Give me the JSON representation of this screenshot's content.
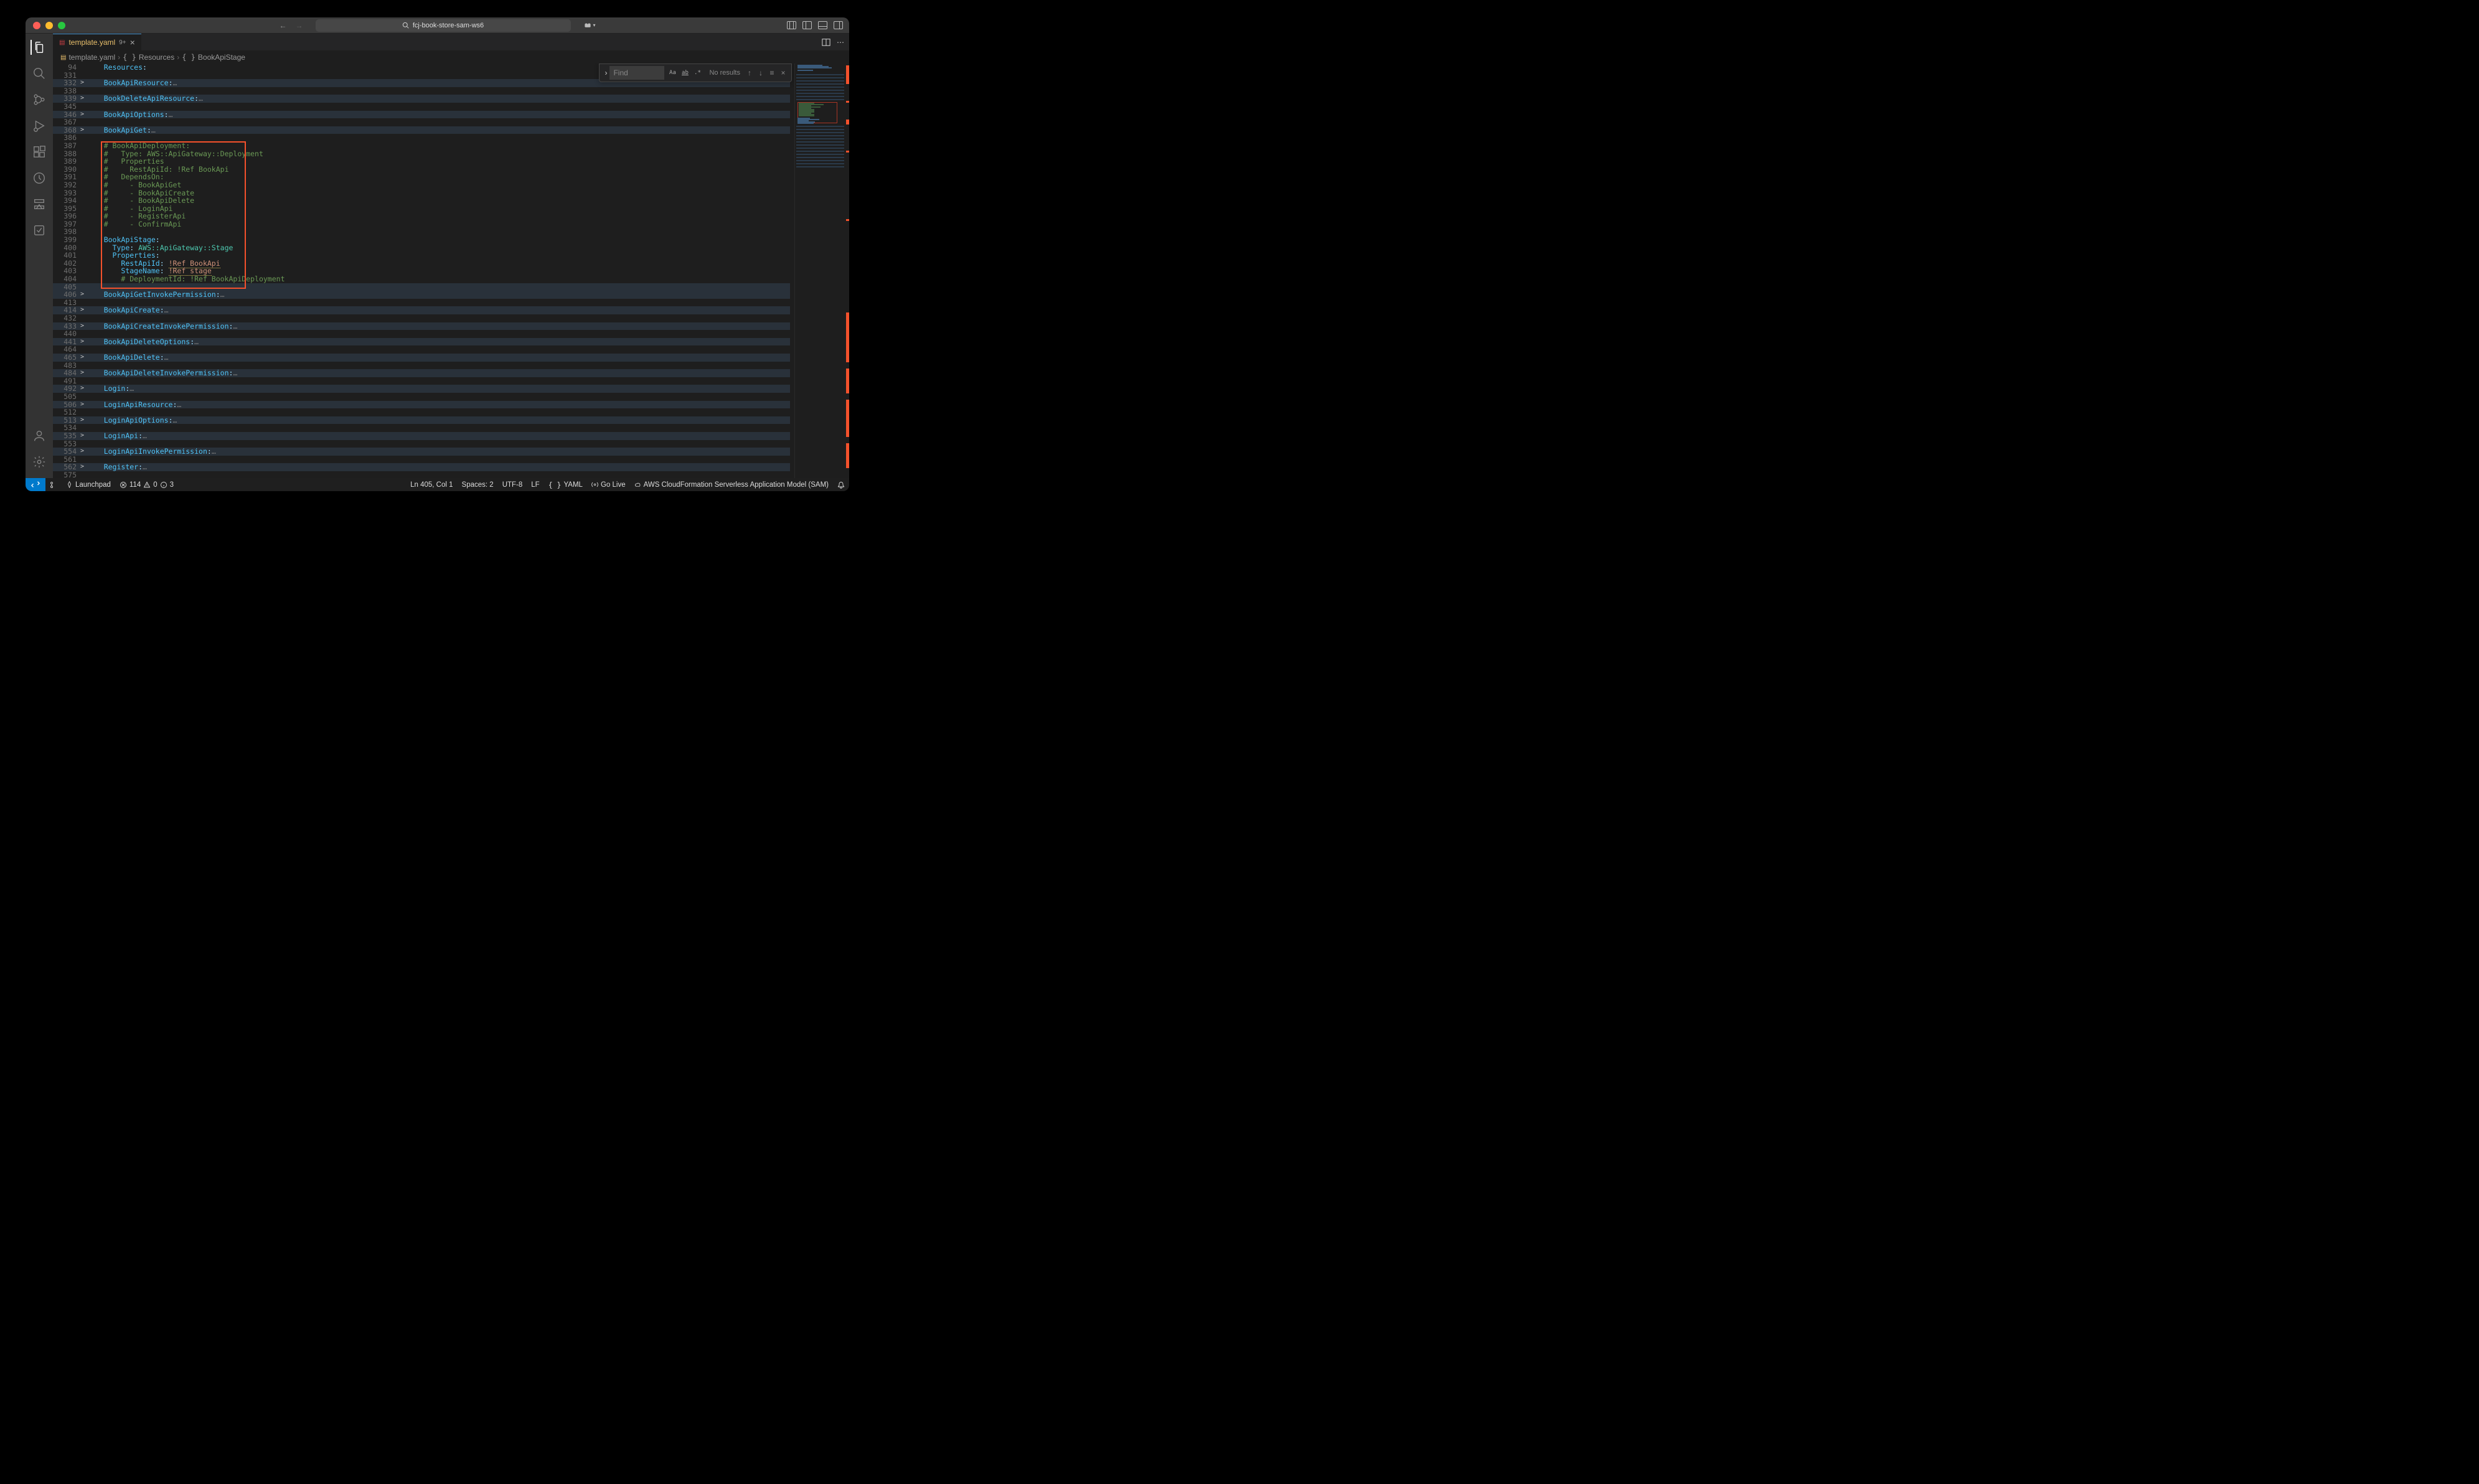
{
  "titlebar": {
    "url": "fcj-book-store-sam-ws6"
  },
  "tab": {
    "filename": "template.yaml",
    "dirty_badge": "9+"
  },
  "breadcrumb": {
    "file": "template.yaml",
    "seg1": "Resources",
    "seg2": "BookApiStage"
  },
  "find": {
    "placeholder": "Find",
    "results": "No results"
  },
  "code_lines": [
    {
      "n": 94,
      "fold": "",
      "cls": "",
      "html": "    <span class='c-key'>Resources</span>:"
    },
    {
      "n": 331,
      "fold": "",
      "cls": "empty",
      "html": " "
    },
    {
      "n": 332,
      "fold": ">",
      "cls": "folded",
      "html": "    <span class='c-key'>BookApiResource</span>:<span class='c-elide'>…</span>"
    },
    {
      "n": 338,
      "fold": "",
      "cls": "empty",
      "html": " "
    },
    {
      "n": 339,
      "fold": ">",
      "cls": "folded",
      "html": "    <span class='c-key'>BookDeleteApiResource</span>:<span class='c-elide'>…</span>"
    },
    {
      "n": 345,
      "fold": "",
      "cls": "empty",
      "html": " "
    },
    {
      "n": 346,
      "fold": ">",
      "cls": "folded",
      "html": "    <span class='c-key'>BookApiOptions</span>:<span class='c-elide'>…</span>"
    },
    {
      "n": 367,
      "fold": "",
      "cls": "empty",
      "html": " "
    },
    {
      "n": 368,
      "fold": ">",
      "cls": "folded",
      "html": "    <span class='c-key'>BookApiGet</span>:<span class='c-elide'>…</span>"
    },
    {
      "n": 386,
      "fold": "",
      "cls": "empty",
      "html": " "
    },
    {
      "n": 387,
      "fold": "",
      "cls": "",
      "html": "    <span class='c-comment'># BookApiDeployment:</span>"
    },
    {
      "n": 388,
      "fold": "",
      "cls": "",
      "html": "    <span class='c-comment'>#   Type: AWS::ApiGateway::Deployment</span>"
    },
    {
      "n": 389,
      "fold": "",
      "cls": "",
      "html": "    <span class='c-comment'>#   Properties</span>"
    },
    {
      "n": 390,
      "fold": "",
      "cls": "",
      "html": "    <span class='c-comment'>#     RestApiId: !Ref BookApi</span>"
    },
    {
      "n": 391,
      "fold": "",
      "cls": "",
      "html": "    <span class='c-comment'>#   DependsOn:</span>"
    },
    {
      "n": 392,
      "fold": "",
      "cls": "",
      "html": "    <span class='c-comment'>#     - BookApiGet</span>"
    },
    {
      "n": 393,
      "fold": "",
      "cls": "",
      "html": "    <span class='c-comment'>#     - BookApiCreate</span>"
    },
    {
      "n": 394,
      "fold": "",
      "cls": "",
      "html": "    <span class='c-comment'>#     - BookApiDelete</span>"
    },
    {
      "n": 395,
      "fold": "",
      "cls": "",
      "html": "    <span class='c-comment'>#     - LoginApi</span>"
    },
    {
      "n": 396,
      "fold": "",
      "cls": "",
      "html": "    <span class='c-comment'>#     - RegisterApi</span>"
    },
    {
      "n": 397,
      "fold": "",
      "cls": "",
      "html": "    <span class='c-comment'>#     - ConfirmApi</span>"
    },
    {
      "n": 398,
      "fold": "",
      "cls": "empty",
      "html": " "
    },
    {
      "n": 399,
      "fold": "",
      "cls": "",
      "html": "    <span class='c-key'>BookApiStage</span>:"
    },
    {
      "n": 400,
      "fold": "",
      "cls": "",
      "html": "      <span class='c-key'>Type</span>: <span class='c-type'>AWS::ApiGateway::Stage</span>"
    },
    {
      "n": 401,
      "fold": "",
      "cls": "",
      "html": "      <span class='c-key'>Properties</span>:"
    },
    {
      "n": 402,
      "fold": "",
      "cls": "",
      "html": "        <span class='c-key'>RestApiId</span>: <span class='c-tag underline-warn'>!Ref BookApi</span>"
    },
    {
      "n": 403,
      "fold": "",
      "cls": "",
      "html": "        <span class='c-key'>StageName</span>: <span class='c-tag underline-warn'>!Ref stage</span>"
    },
    {
      "n": 404,
      "fold": "",
      "cls": "",
      "html": "        <span class='c-comment'># DeploymentId: !Ref BookApiDeployment</span>"
    },
    {
      "n": 405,
      "fold": "",
      "cls": "folded",
      "html": " "
    },
    {
      "n": 406,
      "fold": ">",
      "cls": "folded",
      "html": "    <span class='c-key'>BookApiGetInvokePermission</span>:<span class='c-elide'>…</span>"
    },
    {
      "n": 413,
      "fold": "",
      "cls": "empty",
      "html": " "
    },
    {
      "n": 414,
      "fold": ">",
      "cls": "folded",
      "html": "    <span class='c-key'>BookApiCreate</span>:<span class='c-elide'>…</span>"
    },
    {
      "n": 432,
      "fold": "",
      "cls": "empty",
      "html": " "
    },
    {
      "n": 433,
      "fold": ">",
      "cls": "folded",
      "html": "    <span class='c-key'>BookApiCreateInvokePermission</span>:<span class='c-elide'>…</span>"
    },
    {
      "n": 440,
      "fold": "",
      "cls": "empty",
      "html": " "
    },
    {
      "n": 441,
      "fold": ">",
      "cls": "folded",
      "html": "    <span class='c-key'>BookApiDeleteOptions</span>:<span class='c-elide'>…</span>"
    },
    {
      "n": 464,
      "fold": "",
      "cls": "empty",
      "html": " "
    },
    {
      "n": 465,
      "fold": ">",
      "cls": "folded",
      "html": "    <span class='c-key'>BookApiDelete</span>:<span class='c-elide'>…</span>"
    },
    {
      "n": 483,
      "fold": "",
      "cls": "empty",
      "html": " "
    },
    {
      "n": 484,
      "fold": ">",
      "cls": "folded",
      "html": "    <span class='c-key'>BookApiDeleteInvokePermission</span>:<span class='c-elide'>…</span>"
    },
    {
      "n": 491,
      "fold": "",
      "cls": "empty",
      "html": " "
    },
    {
      "n": 492,
      "fold": ">",
      "cls": "folded",
      "html": "    <span class='c-key'>Login</span>:<span class='c-elide'>…</span>"
    },
    {
      "n": 505,
      "fold": "",
      "cls": "empty",
      "html": " "
    },
    {
      "n": 506,
      "fold": ">",
      "cls": "folded",
      "html": "    <span class='c-key'>LoginApiResource</span>:<span class='c-elide'>…</span>"
    },
    {
      "n": 512,
      "fold": "",
      "cls": "empty",
      "html": " "
    },
    {
      "n": 513,
      "fold": ">",
      "cls": "folded",
      "html": "    <span class='c-key'>LoginApiOptions</span>:<span class='c-elide'>…</span>"
    },
    {
      "n": 534,
      "fold": "",
      "cls": "empty",
      "html": " "
    },
    {
      "n": 535,
      "fold": ">",
      "cls": "folded",
      "html": "    <span class='c-key'>LoginApi</span>:<span class='c-elide'>…</span>"
    },
    {
      "n": 553,
      "fold": "",
      "cls": "empty",
      "html": " "
    },
    {
      "n": 554,
      "fold": ">",
      "cls": "folded",
      "html": "    <span class='c-key'>LoginApiInvokePermission</span>:<span class='c-elide'>…</span>"
    },
    {
      "n": 561,
      "fold": "",
      "cls": "empty",
      "html": " "
    },
    {
      "n": 562,
      "fold": ">",
      "cls": "folded",
      "html": "    <span class='c-key'>Register</span>:<span class='c-elide'>…</span>"
    },
    {
      "n": 575,
      "fold": "",
      "cls": "empty",
      "html": " "
    }
  ],
  "status": {
    "launchpad": "Launchpad",
    "errors": "114",
    "warnings": "0",
    "infos": "3",
    "cursor": "Ln 405, Col 1",
    "spaces": "Spaces: 2",
    "encoding": "UTF-8",
    "eol": "LF",
    "lang": "YAML",
    "golive": "Go Live",
    "context": "AWS CloudFormation Serverless Application Model (SAM)"
  }
}
